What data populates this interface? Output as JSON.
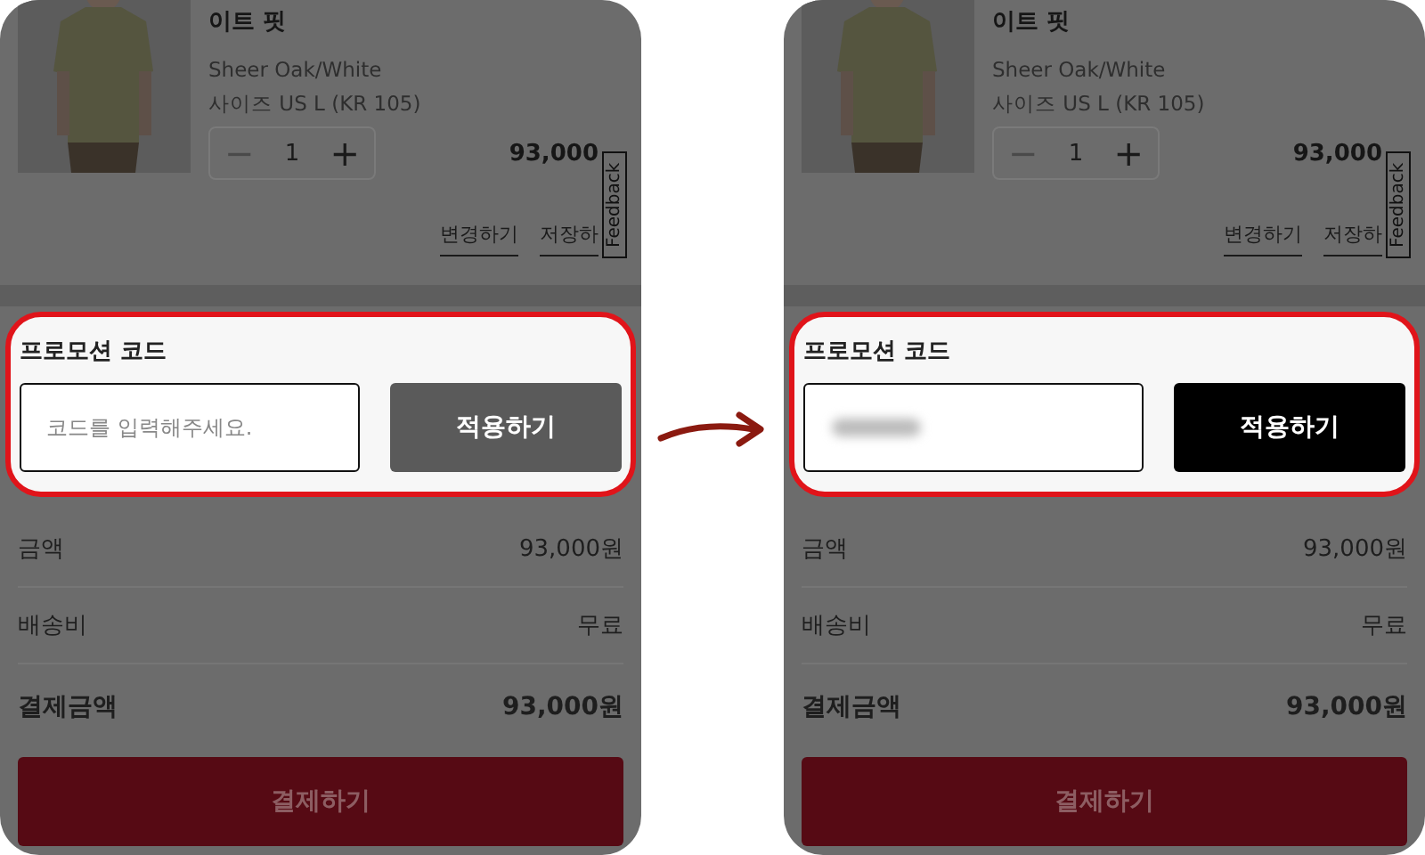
{
  "panels": [
    {
      "product": {
        "name": "이트 핏",
        "color_name": "Sheer Oak/White",
        "size": "사이즈 US L (KR 105)",
        "quantity": "1",
        "decrement": "−",
        "increment": "+",
        "price": "93,000",
        "links": [
          "변경하기",
          "저장하"
        ]
      },
      "feedback_tab": "Feedback",
      "promo": {
        "highlighted": true,
        "title": "프로모션 코드",
        "placeholder": "코드를 입력해주세요.",
        "value_obscured": false,
        "button": {
          "label": "적용하기",
          "enabled": false
        }
      },
      "summary": [
        {
          "label": "금액",
          "value": "93,000원",
          "kind": "normal"
        },
        {
          "label": "배송비",
          "value": "무료",
          "kind": "normal"
        },
        {
          "label": "결제금액",
          "value": "93,000원",
          "kind": "total"
        }
      ],
      "pay_button": {
        "label": "결제하기",
        "enabled": false
      }
    },
    {
      "product": {
        "name": "이트 핏",
        "color_name": "Sheer Oak/White",
        "size": "사이즈 US L (KR 105)",
        "quantity": "1",
        "decrement": "−",
        "increment": "+",
        "price": "93,000",
        "links": [
          "변경하기",
          "저장하"
        ]
      },
      "feedback_tab": "Feedback",
      "promo": {
        "highlighted": true,
        "title": "프로모션 코드",
        "value_obscured": true,
        "button": {
          "label": "적용하기",
          "enabled": true
        }
      },
      "summary": [
        {
          "label": "금액",
          "value": "93,000원",
          "kind": "normal"
        },
        {
          "label": "배송비",
          "value": "무료",
          "kind": "normal"
        },
        {
          "label": "결제금액",
          "value": "93,000원",
          "kind": "total"
        }
      ],
      "pay_button": {
        "label": "결제하기",
        "enabled": false
      }
    }
  ]
}
